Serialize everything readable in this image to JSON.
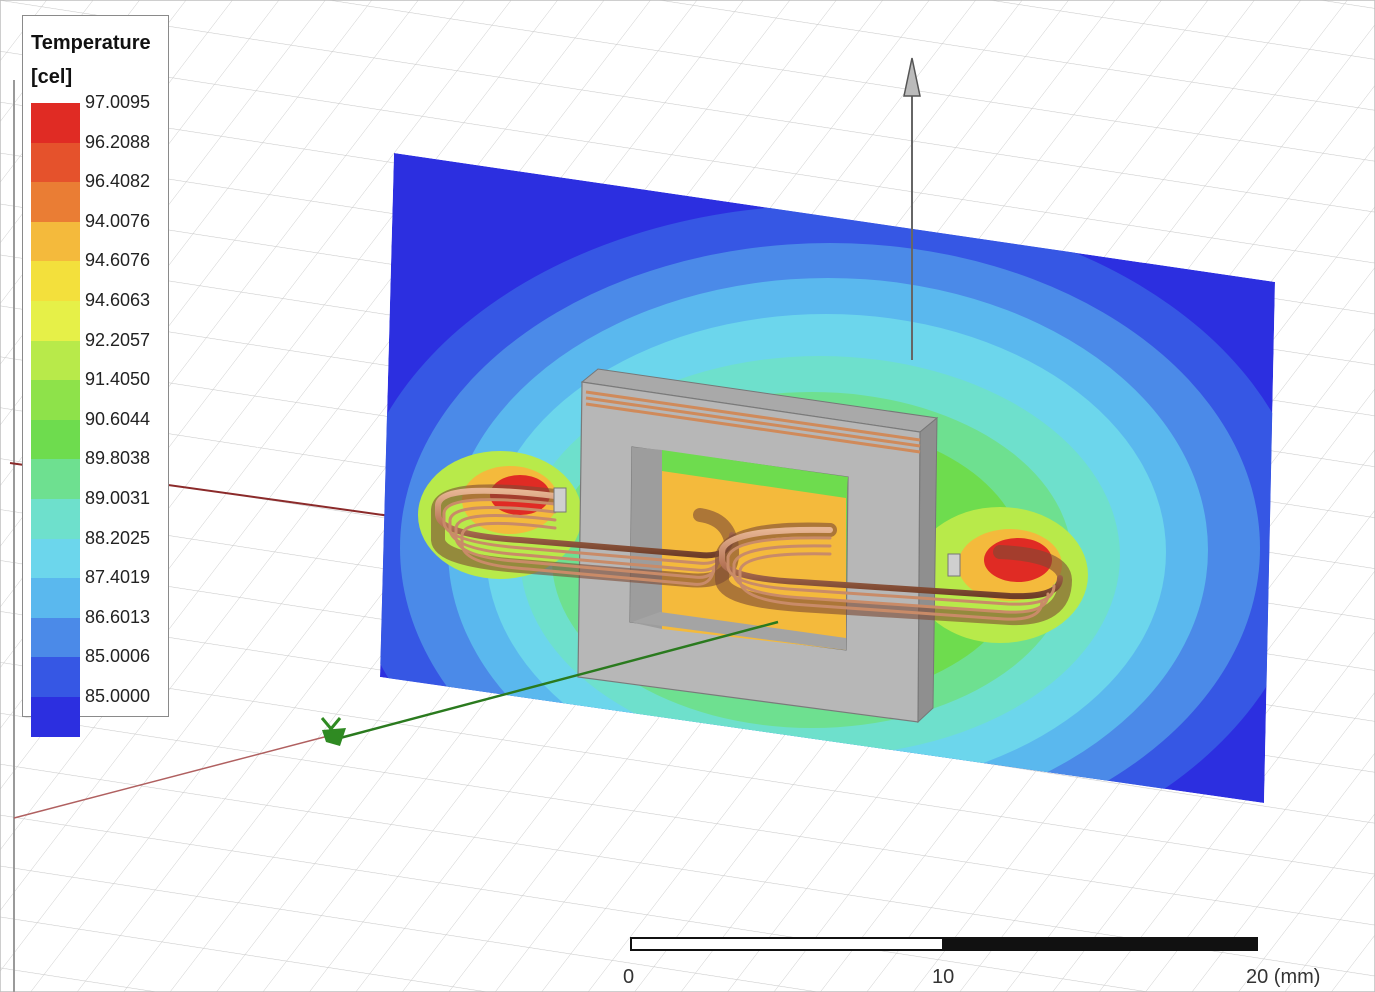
{
  "legend": {
    "title": "Temperature\n[cel]",
    "entries": [
      {
        "value": "97.0095",
        "color": "#e02b24"
      },
      {
        "value": "96.2088",
        "color": "#e5522c"
      },
      {
        "value": "96.4082",
        "color": "#ea7d34"
      },
      {
        "value": "94.0076",
        "color": "#f4ba3c"
      },
      {
        "value": "94.6076",
        "color": "#f3e03c"
      },
      {
        "value": "94.6063",
        "color": "#e6f048"
      },
      {
        "value": "92.2057",
        "color": "#b8ea4a"
      },
      {
        "value": "91.4050",
        "color": "#8ee24a"
      },
      {
        "value": "90.6044",
        "color": "#6edc4e"
      },
      {
        "value": "89.8038",
        "color": "#6ee090"
      },
      {
        "value": "89.0031",
        "color": "#6ee0cc"
      },
      {
        "value": "88.2025",
        "color": "#6cd6ec"
      },
      {
        "value": "87.4019",
        "color": "#5ab8ee"
      },
      {
        "value": "86.6013",
        "color": "#4b8ae8"
      },
      {
        "value": "85.0006",
        "color": "#3657e4"
      },
      {
        "value": "85.0000",
        "color": "#2c2fe0"
      }
    ]
  },
  "scale_bar": {
    "labels": [
      "0",
      "10",
      "20 (mm)"
    ]
  }
}
